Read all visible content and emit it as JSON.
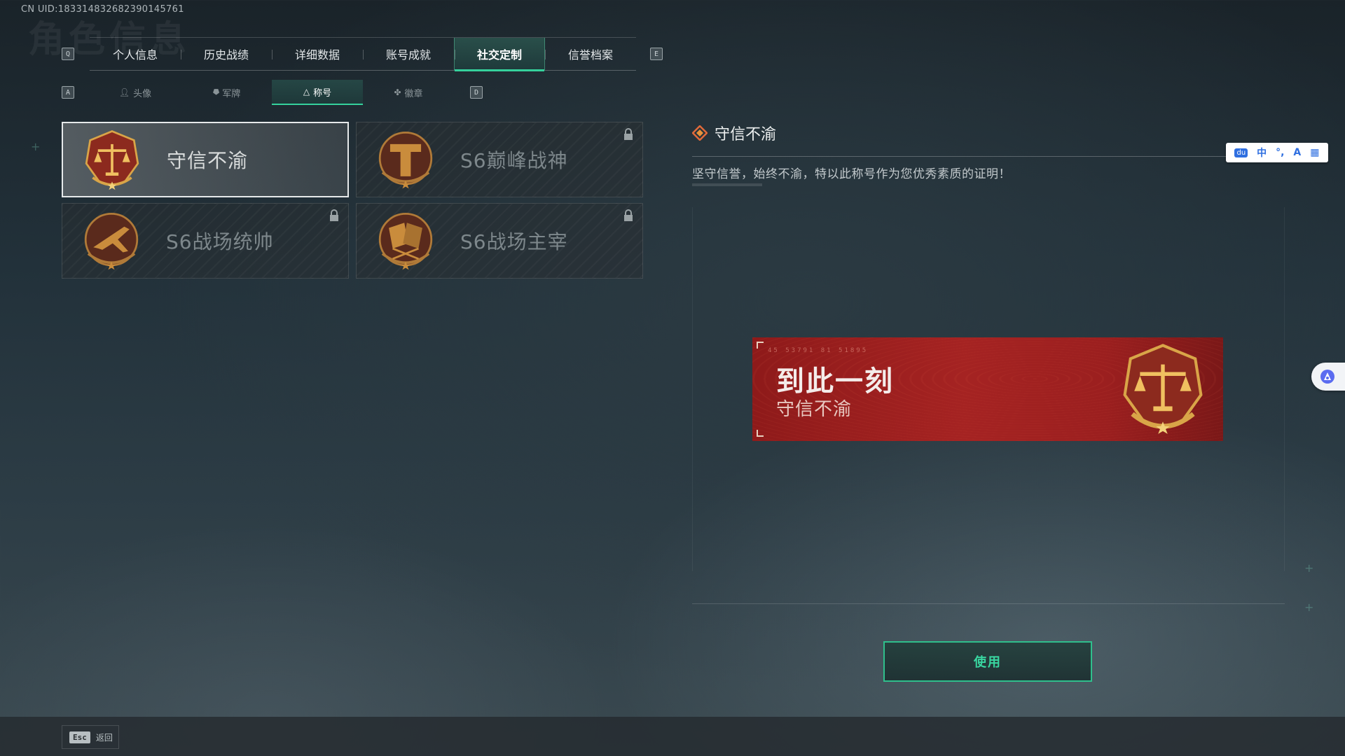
{
  "uid": "CN UID:1833148326823901457​61",
  "main_tabs": [
    {
      "label": "个人信息",
      "active": false
    },
    {
      "label": "历史战绩",
      "active": false
    },
    {
      "label": "详细数据",
      "active": false
    },
    {
      "label": "账号成就",
      "active": false
    },
    {
      "label": "社交定制",
      "active": true
    },
    {
      "label": "信誉档案",
      "active": false
    }
  ],
  "main_tabs_keys": {
    "prev": "Q",
    "next": "E"
  },
  "sub_tabs": [
    {
      "label": "头像",
      "icon": "person-icon",
      "active": false
    },
    {
      "label": "军牌",
      "icon": "dogtag-icon",
      "active": false
    },
    {
      "label": "称号",
      "icon": "title-icon",
      "active": true
    },
    {
      "label": "徽章",
      "icon": "badge-icon",
      "active": false
    }
  ],
  "sub_tabs_keys": {
    "prev": "A",
    "next": "D"
  },
  "titles": [
    {
      "name": "守信不渝",
      "emblem": "scales-emblem",
      "locked": false,
      "selected": true
    },
    {
      "name": "S6巅峰战神",
      "emblem": "t-shield-emblem",
      "locked": true,
      "selected": false
    },
    {
      "name": "S6战场统帅",
      "emblem": "jet-emblem",
      "locked": true,
      "selected": false
    },
    {
      "name": "S6战场主宰",
      "emblem": "flags-emblem",
      "locked": true,
      "selected": false
    }
  ],
  "detail": {
    "title": "守信不渝",
    "description": "坚守信誉，始终不渝，特以此称号作为您优秀素质的证明！"
  },
  "banner": {
    "code": "45 53791 81 51895",
    "main_text": "到此一刻",
    "sub_text": "守信不渝"
  },
  "use_button": "使用",
  "footer": {
    "esc_key": "Esc",
    "esc_label": "返回"
  },
  "ime": {
    "logo": "du",
    "items": [
      "中",
      "°,",
      "A",
      "▦"
    ]
  },
  "colors": {
    "accent": "#35d19c",
    "banner_red": "#a52322",
    "emblem_gold": "#d9a548",
    "emblem_red": "#8c2a1e"
  }
}
